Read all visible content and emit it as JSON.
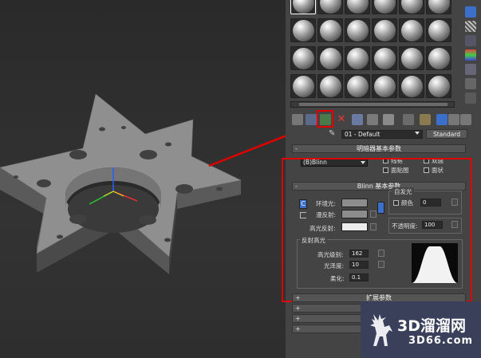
{
  "material_editor": {
    "material_name": "01 - Default",
    "type_button": "Standard"
  },
  "rollouts": {
    "shader_basic": {
      "title": "明暗器基本参数",
      "shader": "(B)Blinn",
      "wire": "线框",
      "two_sided": "双面",
      "face_map": "面贴图",
      "faceted": "面状"
    },
    "blinn_basic": {
      "title": "Blinn 基本参数",
      "ambient": "环境光:",
      "diffuse": "漫反射:",
      "specular": "高光反射:",
      "self_illum": "自发光",
      "color": "颜色",
      "self_illum_value": "0",
      "opacity": "不透明度:",
      "opacity_value": "100",
      "c_lock": "C"
    },
    "specular_highlights": {
      "title": "反射高光",
      "glossiness_level": "高光级别:",
      "glossiness_level_value": "162",
      "glossiness": "光泽度:",
      "glossiness_value": "10",
      "soften": "柔化:",
      "soften_value": "0.1"
    },
    "extended": {
      "title": "扩展参数"
    }
  },
  "watermark": {
    "brand": "3D溜溜网",
    "url": "3D66.com"
  },
  "colors": {
    "annotation_red": "#e00000",
    "ambient_swatch": "#8c8c8c",
    "diffuse_swatch": "#8c8c8c",
    "specular_swatch": "#ececec"
  }
}
